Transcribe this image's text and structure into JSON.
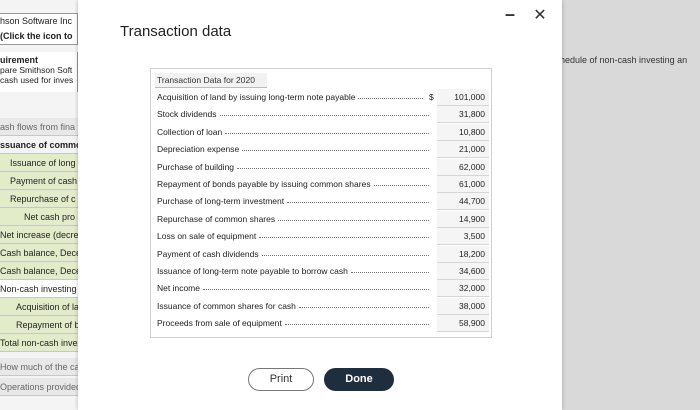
{
  "background": {
    "header_line1": "hson Software Inc",
    "header_line2": "(Click the icon to",
    "requirement_title": "uirement",
    "requirement_line1": "pare Smithson Soft",
    "requirement_line2": "cash used for inves",
    "right_text": "hedule of non-cash investing an",
    "rows": [
      "ash flows from fina",
      "ssuance of commo",
      "Issuance of long",
      "Payment of cash",
      "Repurchase of c",
      "Net cash pro",
      "Net increase (decre",
      "Cash balance, Dece",
      "Cash balance, Dece",
      "Non-cash investing",
      "Acquisition of la",
      "Repayment of b",
      "Total non-cash inve",
      "How much of the cash",
      "Operations provided $"
    ]
  },
  "modal": {
    "title": "Transaction data",
    "minimize_icon": "minimize-icon",
    "close_icon": "close-icon",
    "minimize_glyph": "–",
    "close_glyph": "✕",
    "table_caption": "Transaction Data for 2020",
    "currency_symbol": "$",
    "transactions": [
      {
        "label": "Acquisition of land by issuing long-term note payable",
        "value": "101,000"
      },
      {
        "label": "Stock dividends",
        "value": "31,800"
      },
      {
        "label": "Collection of loan",
        "value": "10,800"
      },
      {
        "label": "Depreciation expense",
        "value": "21,000"
      },
      {
        "label": "Purchase of building",
        "value": "62,000"
      },
      {
        "label": "Repayment of bonds payable by issuing common shares",
        "value": "61,000"
      },
      {
        "label": "Purchase of long-term investment",
        "value": "44,700"
      },
      {
        "label": "Repurchase of common shares",
        "value": "14,900"
      },
      {
        "label": "Loss on sale of equipment",
        "value": "3,500"
      },
      {
        "label": "Payment of cash dividends",
        "value": "18,200"
      },
      {
        "label": "Issuance of long-term note payable to borrow cash",
        "value": "34,600"
      },
      {
        "label": "Net income",
        "value": "32,000"
      },
      {
        "label": "Issuance of common shares for cash",
        "value": "38,000"
      },
      {
        "label": "Proceeds from sale of equipment",
        "value": "58,900"
      }
    ],
    "print_label": "Print",
    "done_label": "Done"
  }
}
